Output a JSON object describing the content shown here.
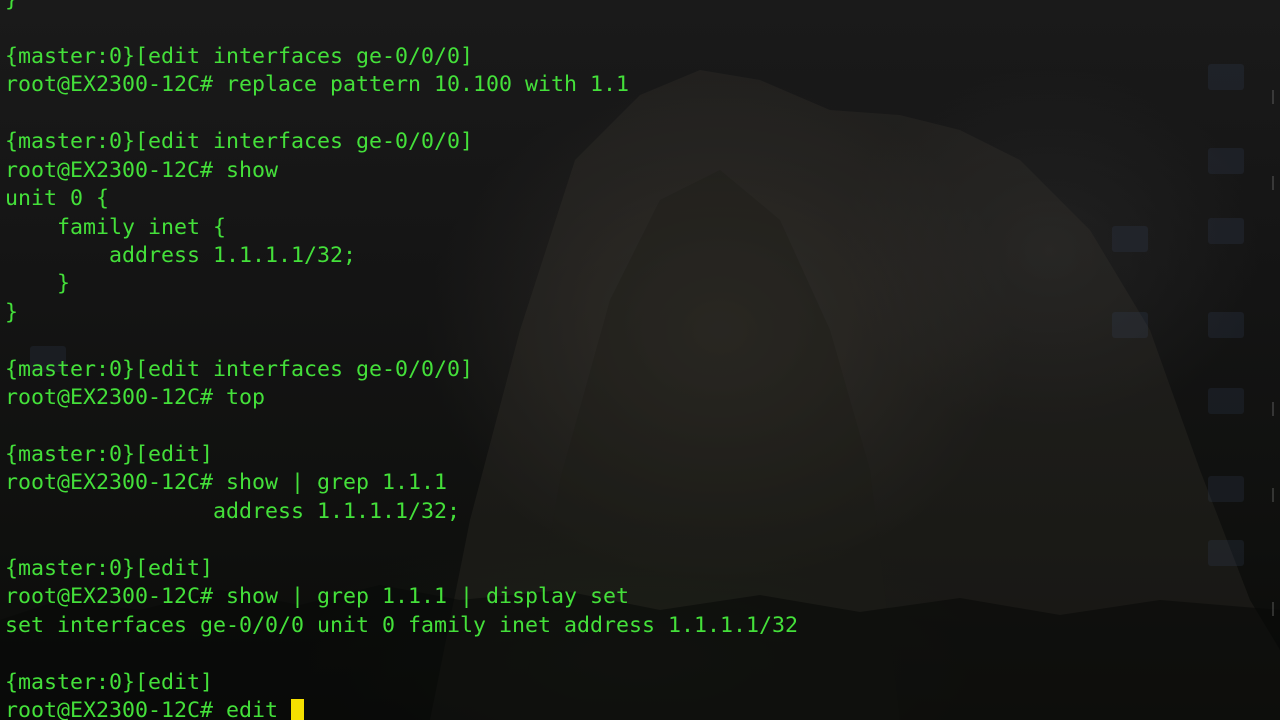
{
  "terminal": {
    "lines": [
      "}",
      "",
      "{master:0}[edit interfaces ge-0/0/0]",
      "root@EX2300-12C# replace pattern 10.100 with 1.1",
      "",
      "{master:0}[edit interfaces ge-0/0/0]",
      "root@EX2300-12C# show",
      "unit 0 {",
      "    family inet {",
      "        address 1.1.1.1/32;",
      "    }",
      "}",
      "",
      "{master:0}[edit interfaces ge-0/0/0]",
      "root@EX2300-12C# top",
      "",
      "{master:0}[edit]",
      "root@EX2300-12C# show | grep 1.1.1",
      "                address 1.1.1.1/32;",
      "",
      "{master:0}[edit]",
      "root@EX2300-12C# show | grep 1.1.1 | display set",
      "set interfaces ge-0/0/0 unit 0 family inet address 1.1.1.1/32",
      "",
      "{master:0}[edit]",
      "root@EX2300-12C# edit"
    ]
  },
  "colors": {
    "text": "#44e03a",
    "cursor": "#f5e000",
    "background": "#141414"
  }
}
